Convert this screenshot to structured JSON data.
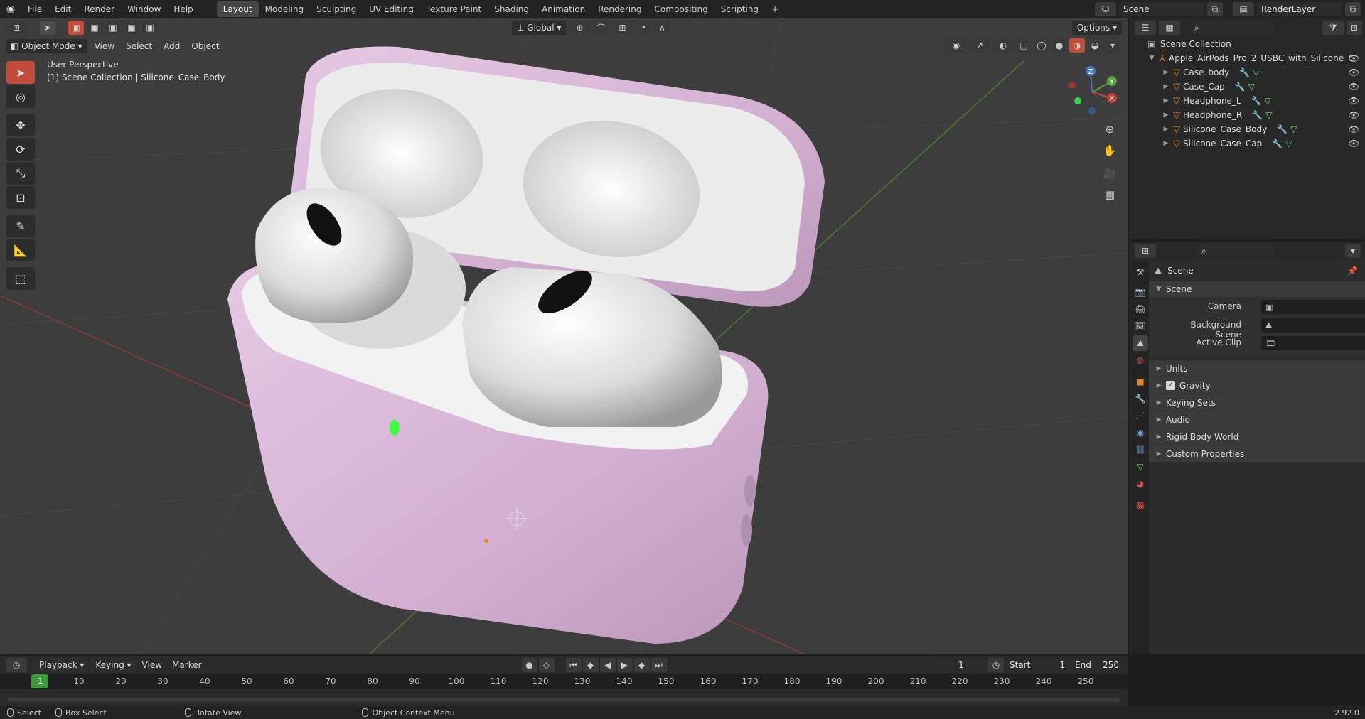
{
  "topbar": {
    "menus": [
      "File",
      "Edit",
      "Render",
      "Window",
      "Help"
    ],
    "workspaces": [
      "Layout",
      "Modeling",
      "Sculpting",
      "UV Editing",
      "Texture Paint",
      "Shading",
      "Animation",
      "Rendering",
      "Compositing",
      "Scripting"
    ],
    "active_workspace": "Layout",
    "add_tab": "+",
    "scene": "Scene",
    "render_layer": "RenderLayer"
  },
  "viewport": {
    "mode": "Object Mode",
    "menus": [
      "View",
      "Select",
      "Add",
      "Object"
    ],
    "orientation": "Global",
    "options": "Options",
    "overlay_title": "User Perspective",
    "overlay_sub": "(1) Scene Collection | Silicone_Case_Body",
    "gizmo_axes": [
      "Z",
      "Y",
      "X"
    ]
  },
  "outliner": {
    "root": "Scene Collection",
    "collection": "Apple_AirPods_Pro_2_USBC_with_Silicone_C",
    "objects": [
      "Case_body",
      "Case_Cap",
      "Headphone_L",
      "Headphone_R",
      "Silicone_Case_Body",
      "Silicone_Case_Cap"
    ]
  },
  "properties": {
    "context": "Scene",
    "panel": "Scene",
    "fields": [
      {
        "label": "Camera"
      },
      {
        "label": "Background Scene"
      },
      {
        "label": "Active Clip"
      }
    ],
    "subpanels": [
      "Units",
      "Gravity",
      "Keying Sets",
      "Audio",
      "Rigid Body World",
      "Custom Properties"
    ]
  },
  "timeline": {
    "menus": [
      "Playback",
      "Keying",
      "View",
      "Marker"
    ],
    "current_frame": "1",
    "start_label": "Start",
    "start": "1",
    "end_label": "End",
    "end": "250",
    "ticks": [
      "1",
      "10",
      "20",
      "30",
      "40",
      "50",
      "60",
      "70",
      "80",
      "90",
      "100",
      "110",
      "120",
      "130",
      "140",
      "150",
      "160",
      "170",
      "180",
      "190",
      "200",
      "210",
      "220",
      "230",
      "240",
      "250"
    ]
  },
  "statusbar": {
    "items": [
      "Select",
      "Box Select",
      "Rotate View",
      "Object Context Menu"
    ],
    "version": "2.92.0"
  },
  "colors": {
    "accent": "#4772b3",
    "object_orange": "#e08a2c",
    "case_pink": "#d7b4d6",
    "frame_green": "#3d9a3d"
  }
}
